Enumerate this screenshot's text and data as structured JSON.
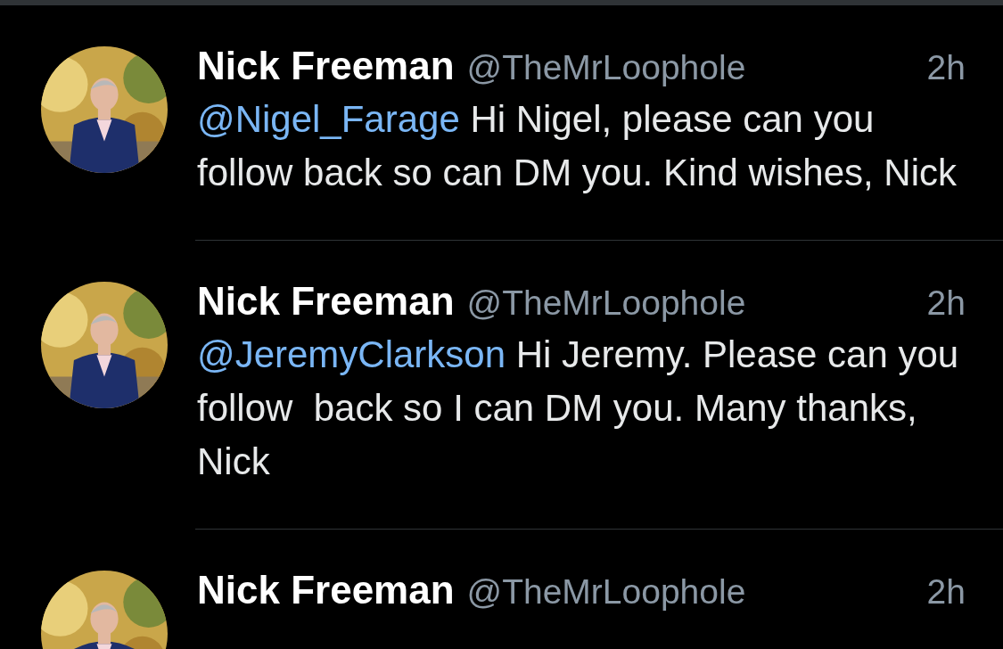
{
  "tweets": [
    {
      "name": "Nick Freeman",
      "handle": "@TheMrLoophole",
      "time": "2h",
      "mention": "@Nigel_Farage",
      "text": " Hi Nigel, please can you follow back so can DM you. Kind wishes, Nick"
    },
    {
      "name": "Nick Freeman",
      "handle": "@TheMrLoophole",
      "time": "2h",
      "mention": "@JeremyClarkson",
      "text": " Hi Jeremy. Please can you follow  back so I can DM you. Many thanks, Nick"
    },
    {
      "name": "Nick Freeman",
      "handle": "@TheMrLoophole",
      "time": "2h"
    }
  ]
}
